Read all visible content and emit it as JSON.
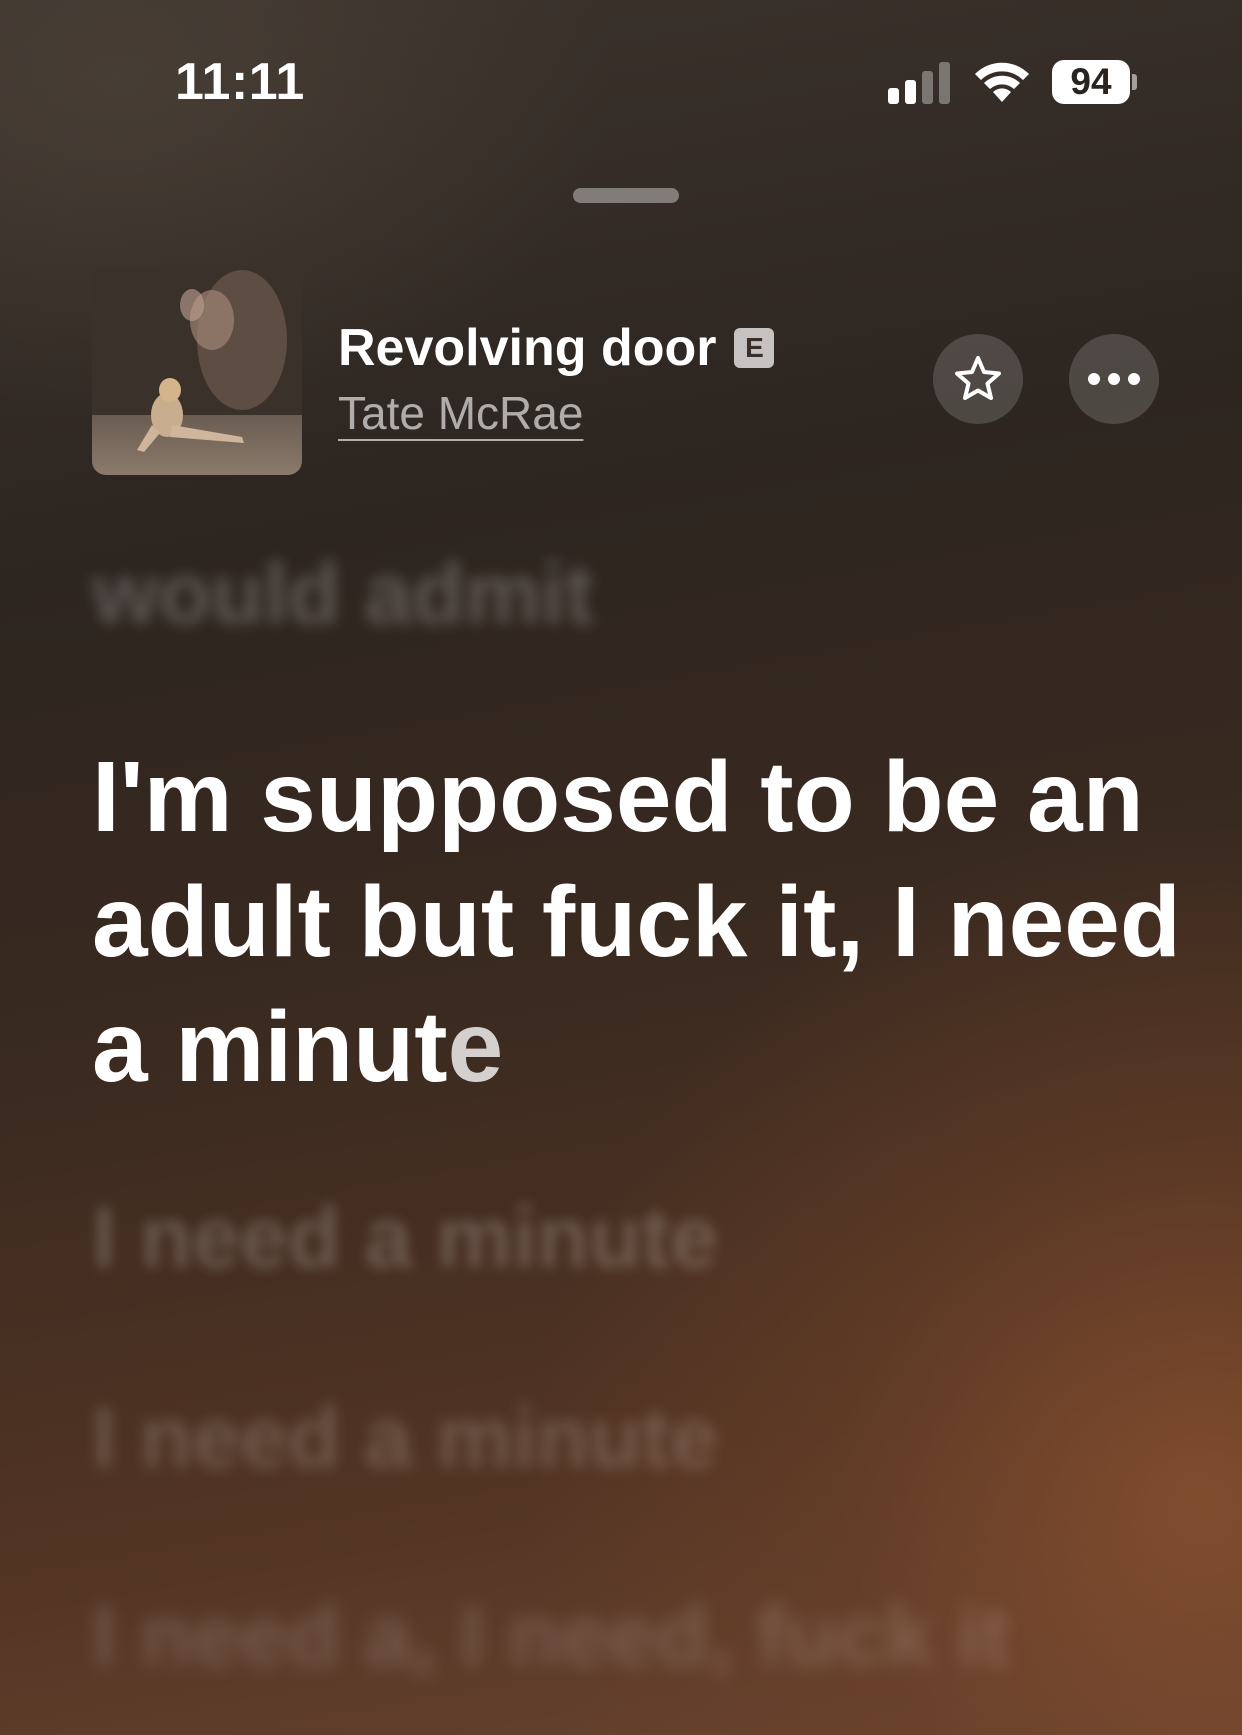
{
  "status_bar": {
    "time": "11:11",
    "battery_level": "94",
    "signal_bars_active": 2,
    "signal_bars_total": 4
  },
  "now_playing": {
    "song_title": "Revolving door",
    "explicit_badge": "E",
    "artist": "Tate McRae",
    "artwork_icon": "album-artwork",
    "favorite_icon": "star-icon",
    "more_icon": "ellipsis-icon"
  },
  "lyrics": {
    "previous": "would admit",
    "current_main": "I'm supposed to be an adult but fuck it, I need a minut",
    "current_tail": "e",
    "upcoming": [
      "I need a minute",
      "I need a minute",
      "I need a, I need, fuck it"
    ]
  },
  "colors": {
    "background_top": "#3c332d",
    "background_bottom": "#6a4431",
    "text": "#ffffff"
  }
}
